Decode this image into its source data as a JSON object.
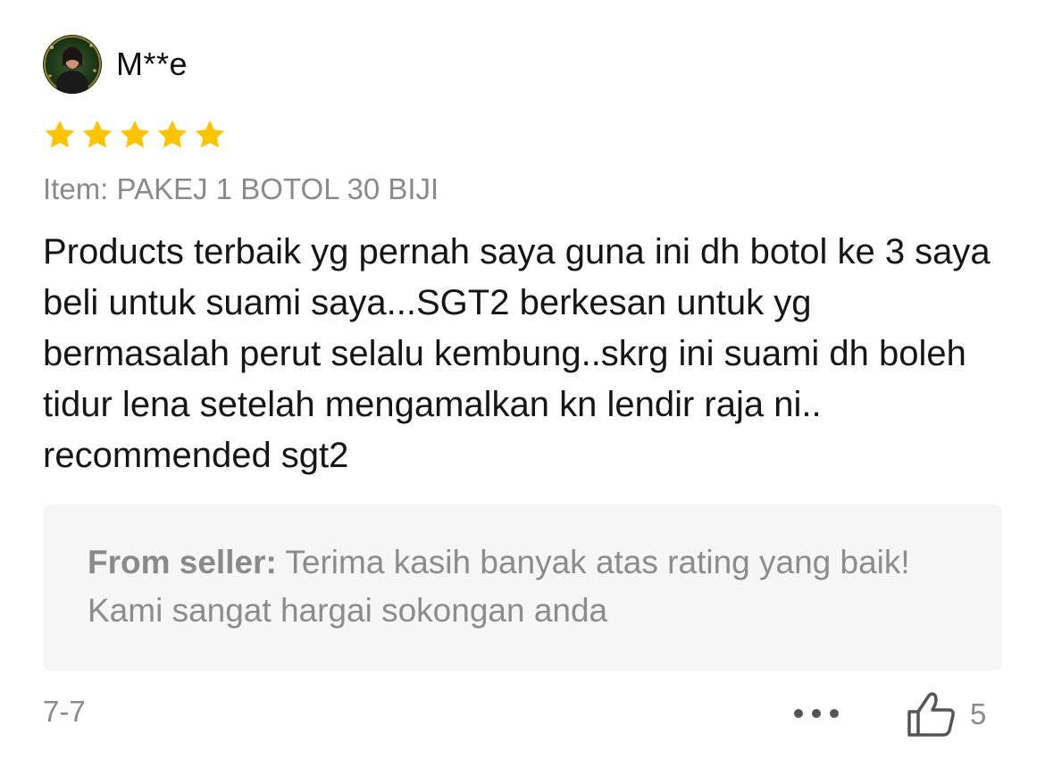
{
  "review": {
    "username": "M**e",
    "rating": 5,
    "max_rating": 5,
    "star_color": "#FFC400",
    "item_variant": "Item: PAKEJ 1 BOTOL 30 BIJI",
    "text": "Products terbaik yg pernah saya guna ini dh botol ke 3 saya beli untuk suami saya...SGT2 berkesan untuk yg bermasalah perut selalu kembung..skrg ini suami dh boleh tidur lena setelah mengamalkan kn lendir raja ni.. recommended sgt2",
    "seller_reply": {
      "label": "From seller:",
      "text": " Terima kasih banyak atas rating yang baik! Kami sangat hargai sokongan anda"
    },
    "date": "7-7",
    "likes": "5"
  },
  "icons": {
    "more": "more-dots-icon",
    "like": "thumbs-up-icon",
    "star": "star-icon"
  }
}
